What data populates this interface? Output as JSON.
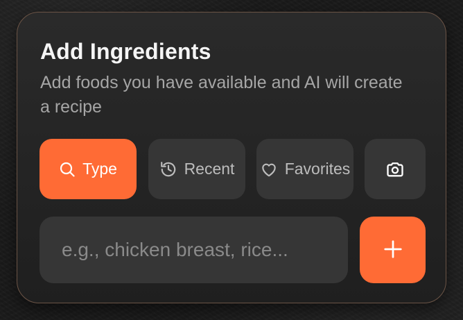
{
  "header": {
    "title": "Add Ingredients",
    "subtitle": "Add foods you have available and AI will create a recipe"
  },
  "tabs": [
    {
      "label": "Type",
      "icon": "search-icon",
      "active": true
    },
    {
      "label": "Recent",
      "icon": "history-icon",
      "active": false
    },
    {
      "label": "Favorites",
      "icon": "heart-icon",
      "active": false
    },
    {
      "label": "",
      "icon": "camera-icon",
      "active": false
    }
  ],
  "ingredient_input": {
    "value": "",
    "placeholder": "e.g., chicken breast, rice..."
  },
  "add_button": {
    "icon": "plus-icon"
  },
  "colors": {
    "accent": "#ff6b35",
    "card_border": "#6b5446",
    "card_bg": "#2a2a2a",
    "control_bg": "#363636",
    "text_primary": "#f5f5f5",
    "text_secondary": "#a6a6a6"
  }
}
